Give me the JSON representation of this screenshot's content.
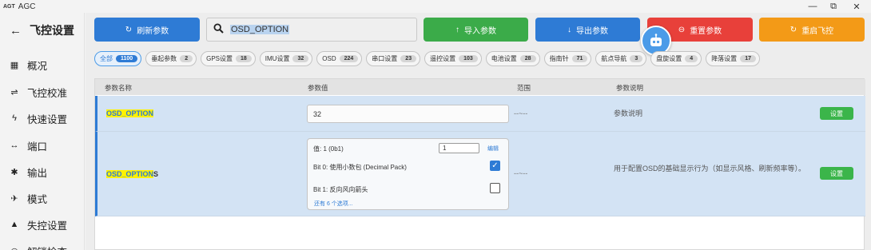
{
  "titlebar": {
    "logo": "AGT",
    "title": "AGC",
    "minimize": "—",
    "maximize": "⧉",
    "close": "✕"
  },
  "sidebar": {
    "title": "飞控设置",
    "back_icon": "←",
    "items": [
      {
        "icon": "▦",
        "label": "概况"
      },
      {
        "icon": "⇌",
        "label": "飞控校准"
      },
      {
        "icon": "ϟ",
        "label": "快速设置"
      },
      {
        "icon": "↔",
        "label": "端口"
      },
      {
        "icon": "✱",
        "label": "输出"
      },
      {
        "icon": "✈",
        "label": "模式"
      },
      {
        "icon": "▲",
        "label": "失控设置"
      },
      {
        "icon": "◎",
        "label": "解锁检查"
      }
    ]
  },
  "toolbar": {
    "refresh": {
      "icon": "↻",
      "label": "刷新参数",
      "color": "#2e7bd5"
    },
    "import": {
      "icon": "↑",
      "label": "导入参数",
      "color": "#3bab49"
    },
    "export": {
      "icon": "↓",
      "label": "导出参数",
      "color": "#2e7bd5"
    },
    "reset": {
      "icon": "⊖",
      "label": "重置参数",
      "color": "#e8403a"
    },
    "reboot": {
      "icon": "↻",
      "label": "重启飞控",
      "color": "#f39a17"
    },
    "robot_icon": "☺"
  },
  "search": {
    "icon": "🔍",
    "value": "OSD_OPTION"
  },
  "chips": [
    {
      "label": "全部",
      "count": "1100",
      "active": true
    },
    {
      "label": "垂起参数",
      "count": "2"
    },
    {
      "label": "GPS设置",
      "count": "18"
    },
    {
      "label": "IMU设置",
      "count": "32"
    },
    {
      "label": "OSD",
      "count": "224"
    },
    {
      "label": "串口设置",
      "count": "23"
    },
    {
      "label": "遥控设置",
      "count": "103"
    },
    {
      "label": "电池设置",
      "count": "28"
    },
    {
      "label": "指南针",
      "count": "71"
    },
    {
      "label": "航点导航",
      "count": "3"
    },
    {
      "label": "盘旋设置",
      "count": "4"
    },
    {
      "label": "降落设置",
      "count": "17"
    }
  ],
  "table": {
    "headers": {
      "name": "参数名称",
      "value": "参数值",
      "range": "范围",
      "desc": "参数说明"
    },
    "rows": [
      {
        "name_hl": "OSD_OPTION",
        "name_rest": "",
        "value": "32",
        "range": "--~--",
        "desc": "参数说明",
        "action": "设置"
      },
      {
        "name_hl": "OSD_OPTION",
        "name_rest": "S",
        "value_label": "值: 1 (0b1)",
        "value_input": "1",
        "edit": "编辑",
        "bit0": "Bit 0: 使用小数包 (Decimal Pack)",
        "bit1": "Bit 1: 反向风向箭头",
        "bit0_checked": "✓",
        "more": "还有 6 个选项...",
        "range": "--~--",
        "desc": "用于配置OSD的基础显示行为（如显示风格、刷新频率等）。",
        "action": "设置"
      }
    ]
  }
}
